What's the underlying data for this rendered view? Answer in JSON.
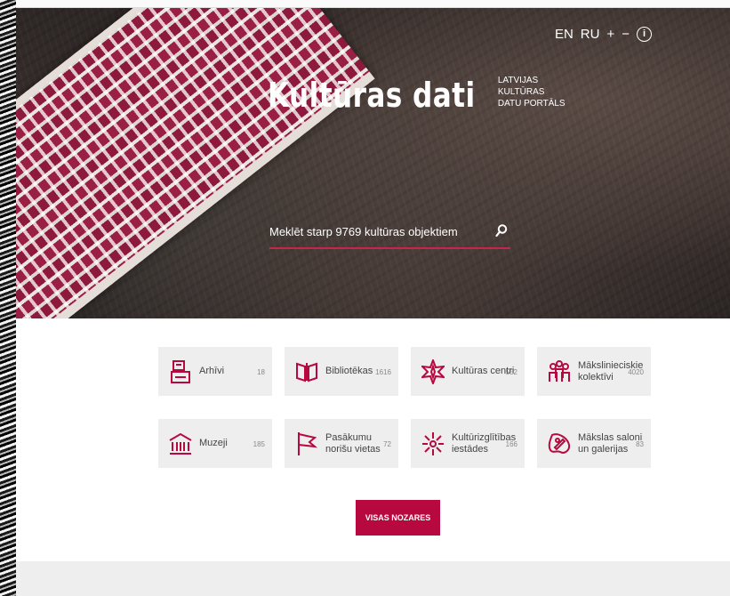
{
  "header": {
    "languages": [
      "EN",
      "RU"
    ],
    "font_increase": "+",
    "font_decrease": "−",
    "info": "i"
  },
  "brand": {
    "title": "Kultūras dati",
    "subtitle_line1": "LATVIJAS KULTŪRAS",
    "subtitle_line2": "DATU PORTĀLS"
  },
  "search": {
    "placeholder": "Meklēt starp 9769 kultūras objektiem"
  },
  "categories": [
    {
      "label": "Arhīvi",
      "count": "18",
      "icon": "archive-icon"
    },
    {
      "label": "Bibliotēkas",
      "count": "1616",
      "icon": "library-book-icon"
    },
    {
      "label": "Kultūras centri",
      "count": "552",
      "icon": "culture-centre-star-icon"
    },
    {
      "label": "Mākslinieciskie kolektīvi",
      "count": "4020",
      "icon": "art-collective-icon"
    },
    {
      "label": "Muzeji",
      "count": "185",
      "icon": "museum-icon"
    },
    {
      "label": "Pasākumu norišu vietas",
      "count": "72",
      "icon": "event-venue-flag-icon"
    },
    {
      "label": "Kultūrizglītības iestādes",
      "count": "166",
      "icon": "culture-education-icon"
    },
    {
      "label": "Mākslas saloni un galerijas",
      "count": "83",
      "icon": "art-gallery-icon"
    }
  ],
  "all_button": "VISAS NOZARES",
  "colors": {
    "accent": "#b7093f",
    "tile_bg": "#eeeeee",
    "icon": "#b7093f"
  }
}
